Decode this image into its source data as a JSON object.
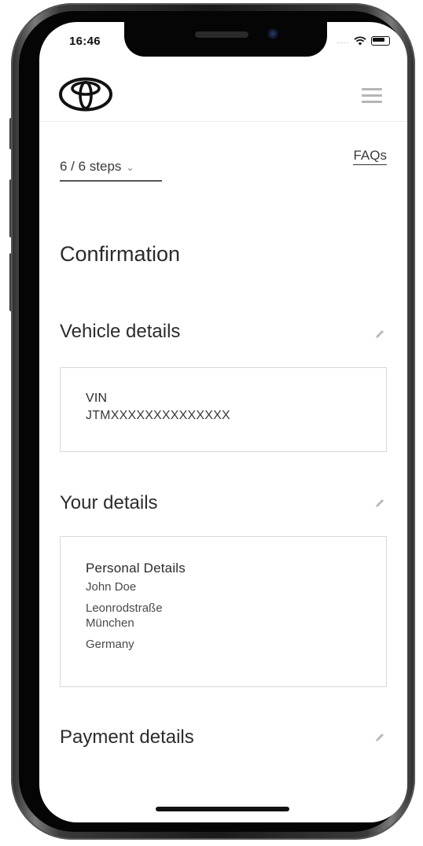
{
  "status_bar": {
    "time": "16:46",
    "signal_dots": "....",
    "icons": [
      "wifi-icon",
      "battery-icon"
    ]
  },
  "header": {
    "logo": "toyota-logo",
    "menu_icon": "hamburger-menu-icon"
  },
  "progress": {
    "steps_label": "6 / 6 steps",
    "dropdown_icon": "chevron-down-icon"
  },
  "faqs_label": "FAQs",
  "page_title": "Confirmation",
  "vehicle_section": {
    "title": "Vehicle details",
    "edit_icon": "pencil-icon",
    "vin_label": "VIN",
    "vin_value": "JTMXXXXXXXXXXXXXX"
  },
  "your_details_section": {
    "title": "Your details",
    "edit_icon": "pencil-icon",
    "card_heading": "Personal Details",
    "name": "John Doe",
    "street": "Leonrodstraße",
    "city": "München",
    "country": "Germany"
  },
  "payment_section": {
    "title": "Payment details",
    "edit_icon": "pencil-icon"
  },
  "colors": {
    "text_primary": "#2b2b2b",
    "text_secondary": "#4a4a4a",
    "border": "#d9d9d9",
    "menu_icon": "#b5b5b5"
  }
}
